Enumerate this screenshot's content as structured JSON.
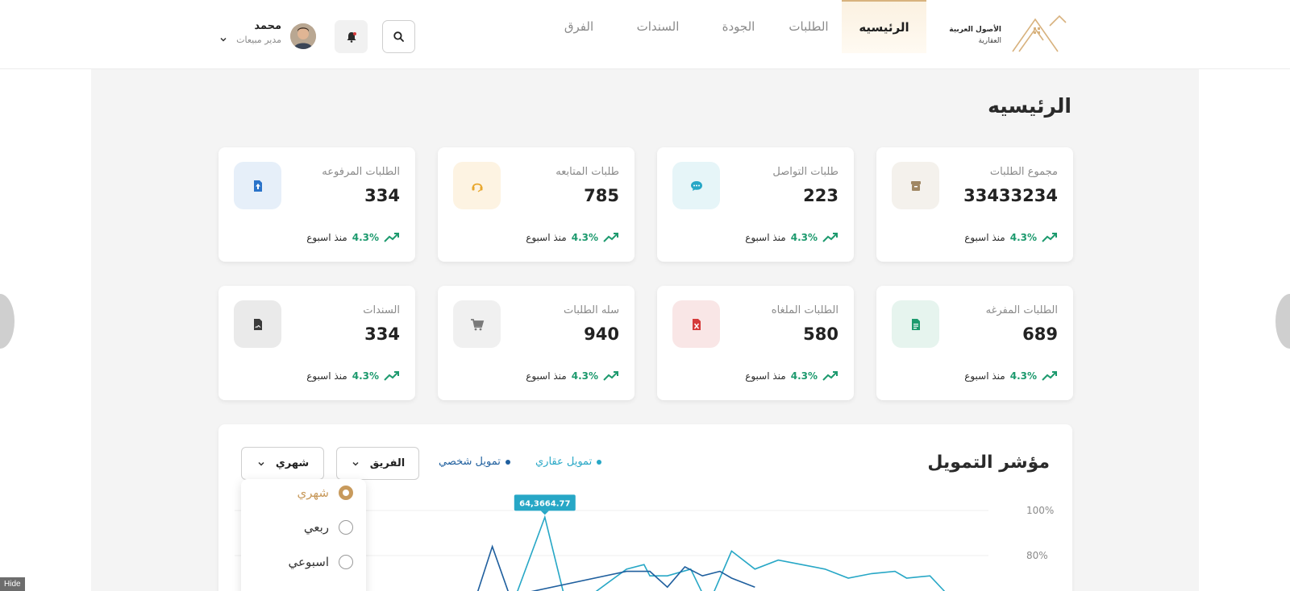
{
  "brand": {
    "name": "الأصول العربية",
    "sub": "العقارية",
    "color": "#d8b27e"
  },
  "nav": {
    "items": [
      {
        "label": "الرئيسيه",
        "active": true
      },
      {
        "label": "الطلبات"
      },
      {
        "label": "الجودة"
      },
      {
        "label": "السندات"
      },
      {
        "label": "الفرق"
      }
    ]
  },
  "header_icons": {
    "search": "search-icon",
    "notifications": "bell-icon"
  },
  "user": {
    "name": "محمد",
    "role": "مدير مبيعات"
  },
  "page": {
    "title": "الرئيسيه"
  },
  "cards": [
    {
      "label": "مجموع الطلبات",
      "value": "33433234",
      "trend": "4.3%",
      "since": "منذ اسبوع",
      "icon": "archive-box-icon",
      "icon_color": "#a08763",
      "icon_bg": "#f4f1ec"
    },
    {
      "label": "طلبات التواصل",
      "value": "223",
      "trend": "4.3%",
      "since": "منذ اسبوع",
      "icon": "chat-bubble-icon",
      "icon_color": "#27a7c6",
      "icon_bg": "#e6f5f8"
    },
    {
      "label": "طلبات المتابعه",
      "value": "785",
      "trend": "4.3%",
      "since": "منذ اسبوع",
      "icon": "headset-icon",
      "icon_color": "#e8a62b",
      "icon_bg": "#fdf3e2"
    },
    {
      "label": "الطلبات المرفوعه",
      "value": "334",
      "trend": "4.3%",
      "since": "منذ اسبوع",
      "icon": "file-upload-icon",
      "icon_color": "#2a73c9",
      "icon_bg": "#e6eff9"
    },
    {
      "label": "الطلبات المفرغه",
      "value": "689",
      "trend": "4.3%",
      "since": "منذ اسبوع",
      "icon": "file-text-icon",
      "icon_color": "#1d9a6e",
      "icon_bg": "#e6f4ee"
    },
    {
      "label": "الطلبات الملغاه",
      "value": "580",
      "trend": "4.3%",
      "since": "منذ اسبوع",
      "icon": "file-excel-icon",
      "icon_color": "#d53a3a",
      "icon_bg": "#f9e6e6"
    },
    {
      "label": "سله الطلبات",
      "value": "940",
      "trend": "4.3%",
      "since": "منذ اسبوع",
      "icon": "shopping-cart-icon",
      "icon_color": "#7a7a7a",
      "icon_bg": "#f0f0f0"
    },
    {
      "label": "السندات",
      "value": "334",
      "trend": "4.3%",
      "since": "منذ اسبوع",
      "icon": "file-signature-icon",
      "icon_color": "#3a3a3a",
      "icon_bg": "#eaeaea"
    }
  ],
  "chart_panel": {
    "title": "مؤشر التمويل",
    "legend": [
      {
        "label": "تمويل عقاري",
        "color": "#27a7c6"
      },
      {
        "label": "تمويل شخصي",
        "color": "#1f5f9e"
      }
    ],
    "team_select": "الفريق",
    "period_select": "شهري",
    "period_options": [
      {
        "label": "شهري",
        "selected": true
      },
      {
        "label": "ربعي",
        "selected": false
      },
      {
        "label": "اسبوعي",
        "selected": false
      }
    ]
  },
  "chart_data": {
    "type": "line",
    "tooltip": "64,3664.77",
    "y_ticks": [
      "100%",
      "80%"
    ],
    "ylim": [
      0,
      100
    ],
    "grid": true,
    "series": [
      {
        "name": "تمويل عقاري",
        "color": "#27a7c6",
        "points": [
          [
            0.52,
            55
          ],
          [
            0.58,
            97
          ],
          [
            0.62,
            55
          ],
          [
            0.72,
            74
          ],
          [
            0.75,
            76
          ],
          [
            0.76,
            71
          ],
          [
            0.79,
            71
          ],
          [
            0.83,
            74
          ],
          [
            0.86,
            58
          ],
          [
            0.9,
            82
          ],
          [
            0.94,
            74
          ],
          [
            0.98,
            78
          ],
          [
            1.02,
            76
          ],
          [
            1.06,
            74
          ],
          [
            1.1,
            70
          ],
          [
            1.14,
            72
          ],
          [
            1.18,
            73
          ],
          [
            1.2,
            70
          ],
          [
            1.24,
            71
          ],
          [
            1.28,
            60
          ]
        ]
      },
      {
        "name": "تمويل شخصي",
        "color": "#1f5f9e",
        "points": [
          [
            0.46,
            60
          ],
          [
            0.49,
            84
          ],
          [
            0.52,
            62
          ],
          [
            0.72,
            73
          ],
          [
            0.76,
            73
          ],
          [
            0.79,
            66
          ],
          [
            0.82,
            75
          ],
          [
            0.85,
            71
          ],
          [
            0.88,
            73
          ],
          [
            0.9,
            70
          ],
          [
            0.94,
            66
          ]
        ]
      }
    ]
  },
  "footer": {
    "hide_label": "Hide"
  }
}
